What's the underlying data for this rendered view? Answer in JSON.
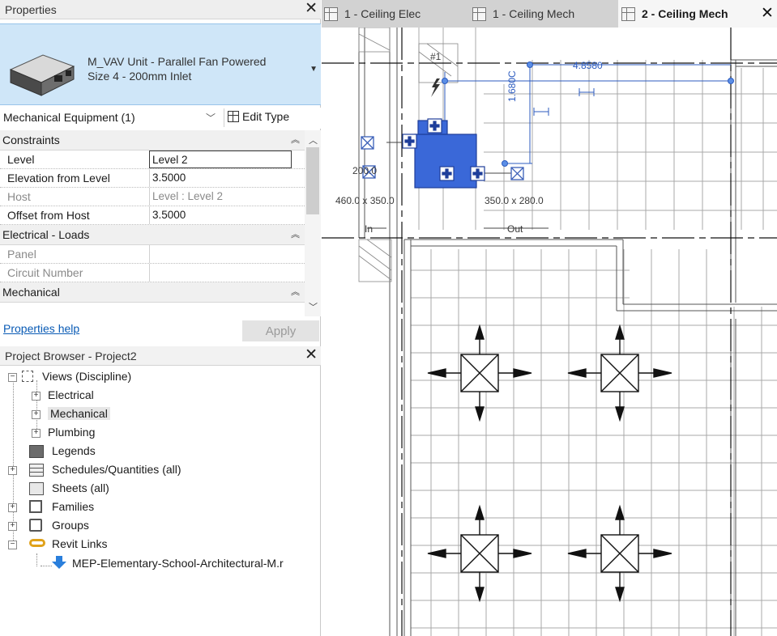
{
  "properties": {
    "title": "Properties",
    "type_name_line1": "M_VAV Unit - Parallel Fan Powered",
    "type_name_line2": "Size 4 - 200mm Inlet",
    "category": "Mechanical Equipment (1)",
    "edit_type_label": "Edit Type",
    "groups": {
      "constraints": "Constraints",
      "electrical": "Electrical - Loads",
      "mechanical": "Mechanical"
    },
    "rows": {
      "level": {
        "name": "Level",
        "value": "Level 2"
      },
      "elevation": {
        "name": "Elevation from Level",
        "value": "3.5000"
      },
      "host": {
        "name": "Host",
        "value": "Level : Level 2"
      },
      "offset": {
        "name": "Offset from Host",
        "value": "3.5000"
      },
      "panel": {
        "name": "Panel",
        "value": ""
      },
      "circuit": {
        "name": "Circuit Number",
        "value": ""
      }
    },
    "help_link": "Properties help",
    "apply_label": "Apply"
  },
  "project_browser": {
    "title": "Project Browser - Project2",
    "items": {
      "views": "Views (Discipline)",
      "electrical": "Electrical",
      "mechanical": "Mechanical",
      "plumbing": "Plumbing",
      "legends": "Legends",
      "schedules": "Schedules/Quantities (all)",
      "sheets": "Sheets (all)",
      "families": "Families",
      "groups": "Groups",
      "revit_links": "Revit Links",
      "link_file": "MEP-Elementary-School-Architectural-M.r"
    }
  },
  "tabs": [
    {
      "label": "1 - Ceiling Elec"
    },
    {
      "label": "1 - Ceiling Mech"
    },
    {
      "label": "2 - Ceiling Mech"
    }
  ],
  "canvas": {
    "grid_label": "#1",
    "dim_horizontal": "4.8580",
    "dim_vertical": "1.680C",
    "duct_size_left": "460.0 x 350.0",
    "duct_size_right": "350.0 x 280.0",
    "duct_size_small": "200.0",
    "label_in": "In",
    "label_out": "Out"
  },
  "colors": {
    "selection_blue": "#3a68d8",
    "dimension_blue": "#2c5bbf",
    "type_selector_bg": "#cfe6f8",
    "link_blue": "#0a5bb5"
  }
}
